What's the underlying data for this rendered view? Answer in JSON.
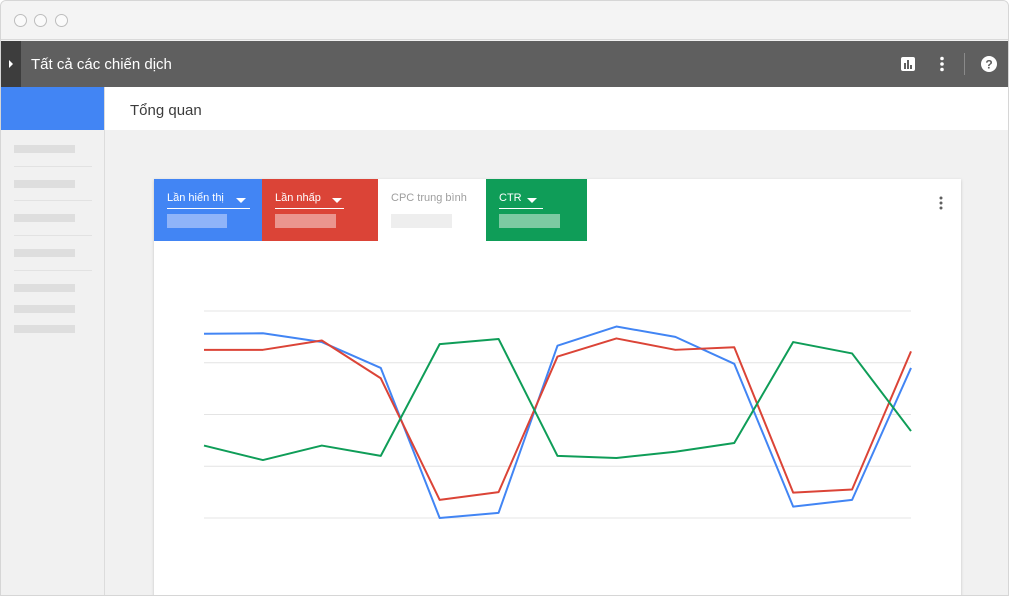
{
  "window": {
    "title": "Tất cả các chiến dịch"
  },
  "page": {
    "title": "Tổng quan"
  },
  "metrics": [
    {
      "label": "Lần hiển thị",
      "color": "#4285f4",
      "selected": true
    },
    {
      "label": "Lần nhấp",
      "color": "#db4437",
      "selected": true
    },
    {
      "label": "CPC trung bình",
      "color": "#ffffff",
      "selected": false
    },
    {
      "label": "CTR",
      "color": "#0f9d58",
      "selected": true
    }
  ],
  "icons": {
    "toggle": "chevron-right-icon",
    "reports": "bar-chart-icon",
    "more": "more-vert-icon",
    "help": "help-icon",
    "card_more": "more-vert-icon"
  },
  "chart_data": {
    "type": "line",
    "title": "",
    "xlabel": "",
    "ylabel": "",
    "x": [
      1,
      2,
      3,
      4,
      5,
      6,
      7,
      8,
      9,
      10,
      11,
      12,
      13
    ],
    "ylim": [
      0,
      4
    ],
    "grid": true,
    "series": [
      {
        "color": "#4285f4",
        "values": [
          3.56,
          3.57,
          3.4,
          2.9,
          0.0,
          0.1,
          3.33,
          3.7,
          3.5,
          2.98,
          0.22,
          0.35,
          2.9
        ]
      },
      {
        "color": "#db4437",
        "values": [
          3.25,
          3.25,
          3.43,
          2.7,
          0.35,
          0.5,
          3.12,
          3.47,
          3.25,
          3.3,
          0.49,
          0.55,
          3.22
        ]
      },
      {
        "color": "#0f9d58",
        "values": [
          1.4,
          1.12,
          1.4,
          1.2,
          3.36,
          3.46,
          1.2,
          1.16,
          1.28,
          1.45,
          3.4,
          3.18,
          1.68
        ]
      }
    ]
  }
}
